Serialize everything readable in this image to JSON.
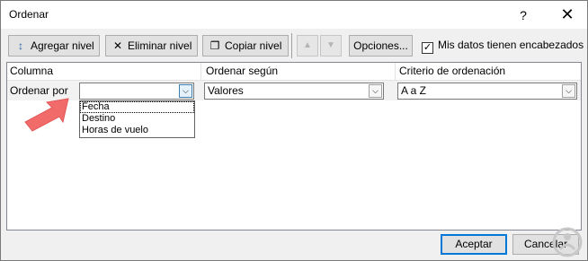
{
  "window": {
    "title": "Ordenar",
    "help_label": "?",
    "close_label": "✕"
  },
  "toolbar": {
    "add_level": {
      "label": "Agregar nivel",
      "icon": "add-level-icon",
      "icon_glyph": "↕"
    },
    "delete_level": {
      "label": "Eliminar nivel",
      "icon": "delete-icon",
      "icon_glyph": "✕"
    },
    "copy_level": {
      "label": "Copiar nivel",
      "icon": "copy-icon",
      "icon_glyph": "❐"
    },
    "move_up_glyph": "▲",
    "move_down_glyph": "▼",
    "options_label": "Opciones...",
    "headers_checkbox": {
      "label": "Mis datos tienen encabezados",
      "checked": true,
      "check_glyph": "✓"
    }
  },
  "grid": {
    "headers": [
      "Columna",
      "Ordenar según",
      "Criterio de ordenación"
    ],
    "rows": [
      {
        "label": "Ordenar por",
        "column_value": "",
        "sort_on_value": "Valores",
        "order_value": "A a Z"
      }
    ],
    "dropdown_glyph": "⌵",
    "column_options": [
      "Fecha",
      "Destino",
      "Horas de vuelo"
    ]
  },
  "buttons": {
    "accept_label": "Aceptar",
    "cancel_label": "Cancelar"
  },
  "colors": {
    "accent": "#0078d7",
    "pointer_arrow": "#f26b6b"
  }
}
